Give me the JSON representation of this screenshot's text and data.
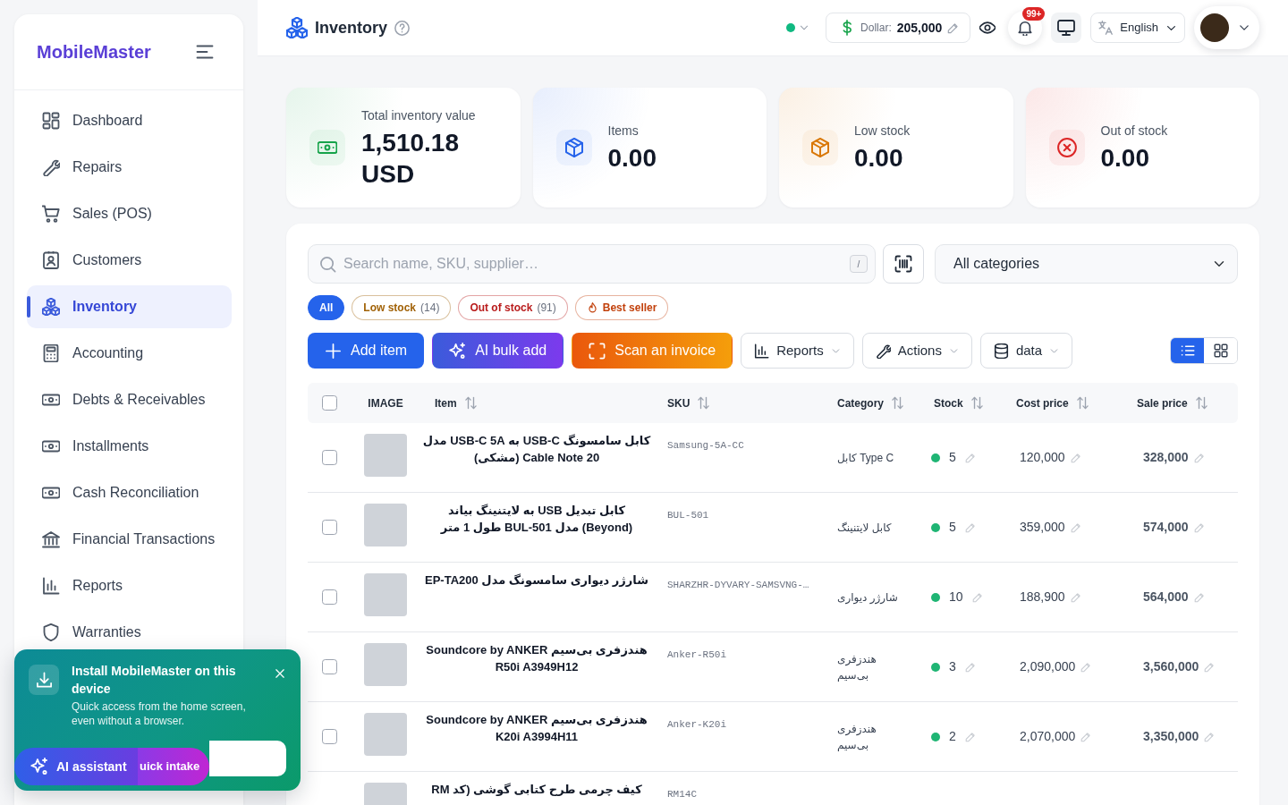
{
  "sidebar": {
    "brand": "MobileMaster",
    "items": [
      {
        "label": "Dashboard",
        "selected": false
      },
      {
        "label": "Repairs",
        "selected": false
      },
      {
        "label": "Sales (POS)",
        "selected": false
      },
      {
        "label": "Customers",
        "selected": false
      },
      {
        "label": "Inventory",
        "selected": true
      },
      {
        "label": "Accounting",
        "selected": false
      },
      {
        "label": "Debts & Receivables",
        "selected": false
      },
      {
        "label": "Installments",
        "selected": false
      },
      {
        "label": "Cash Reconciliation",
        "selected": false
      },
      {
        "label": "Financial Transactions",
        "selected": false
      },
      {
        "label": "Reports",
        "selected": false
      },
      {
        "label": "Warranties",
        "selected": false
      }
    ]
  },
  "install_banner": {
    "title": "Install MobileMaster on this device",
    "text": "Quick access from the home screen, even without a browser."
  },
  "floating": {
    "ai_assistant": "AI assistant",
    "quick_intake": "uick intake"
  },
  "topbar": {
    "title": "Inventory",
    "currency": {
      "label": "Dollar:",
      "value": "205,000"
    },
    "notifications": {
      "badge": "99+"
    },
    "language": "English"
  },
  "stats": [
    {
      "label": "Total inventory value",
      "value": "1,510.18 USD",
      "color": "#16a34a"
    },
    {
      "label": "Items",
      "value": "0.00",
      "color": "#2563eb"
    },
    {
      "label": "Low stock",
      "value": "0.00",
      "color": "#d97706"
    },
    {
      "label": "Out of stock",
      "value": "0.00",
      "color": "#dc2626"
    }
  ],
  "search": {
    "placeholder": "Search name, SKU, supplier…",
    "shortcut": "/"
  },
  "category_filter": {
    "value": "All categories"
  },
  "filters": [
    {
      "label": "All",
      "selected": true,
      "color": "#2563eb"
    },
    {
      "label": "Low stock",
      "count": "(14)",
      "selected": false,
      "color": "#a16207"
    },
    {
      "label": "Out of stock",
      "count": "(91)",
      "selected": false,
      "color": "#b91c1c"
    },
    {
      "label": "Best seller",
      "selected": false,
      "color": "#c2410c"
    }
  ],
  "buttons": [
    {
      "label": "Add item",
      "kind": "primary"
    },
    {
      "label": "AI bulk add",
      "kind": "ai"
    },
    {
      "label": "Scan an invoice",
      "kind": "scan"
    },
    {
      "label": "Reports",
      "kind": "menu"
    },
    {
      "label": "Actions",
      "kind": "menu"
    },
    {
      "label": "data",
      "kind": "menu"
    }
  ],
  "view_toggle": [
    {
      "kind": "list",
      "selected": true
    },
    {
      "kind": "grid",
      "selected": false
    }
  ],
  "table": {
    "select_all": {
      "checked": false
    },
    "columns": [
      {
        "label": "IMAGE",
        "sortable": false
      },
      {
        "label": "Item",
        "sortable": true
      },
      {
        "label": "SKU",
        "sortable": true
      },
      {
        "label": "Category",
        "sortable": true
      },
      {
        "label": "Stock",
        "sortable": true
      },
      {
        "label": "Cost price",
        "sortable": true
      },
      {
        "label": "Sale price",
        "sortable": true
      }
    ],
    "rows": [
      {
        "checked": false,
        "item": "کابل سامسونگ USB-C به USB-C 5A مدل Cable Note 20 (مشکی)",
        "sku": "Samsung-5A-CC",
        "category": "کابل Type C",
        "stock": "5",
        "cost": "120,000",
        "sale": "328,000"
      },
      {
        "checked": false,
        "item": "کابل تبدیل USB به لایتنینگ بیاند (Beyond) مدل BUL-501 طول 1 متر",
        "sku": "BUL-501",
        "category": "کابل لایتنینگ",
        "stock": "5",
        "cost": "359,000",
        "sale": "574,000"
      },
      {
        "checked": false,
        "item": "شارژر دیواری سامسونگ مدل EP-TA200",
        "sku": "SHARZHR-DYVARY-SAMSVNG-…",
        "category": "شارژر دیواری",
        "stock": "10",
        "cost": "188,900",
        "sale": "564,000"
      },
      {
        "checked": false,
        "item": "هندزفری بی‌سیم Soundcore by ANKER R50i A3949H12",
        "sku": "Anker-R50i",
        "category": "هندزفری بی‌سیم",
        "stock": "3",
        "cost": "2,090,000",
        "sale": "3,560,000"
      },
      {
        "checked": false,
        "item": "هندزفری بی‌سیم Soundcore by ANKER K20i A3994H11",
        "sku": "Anker-K20i",
        "category": "هندزفری بی‌سیم",
        "stock": "2",
        "cost": "2,070,000",
        "sale": "3,350,000"
      },
      {
        "item": "کیف چرمی طرح کتابی گوشی (کد RM",
        "sku": "RM14C"
      }
    ]
  }
}
